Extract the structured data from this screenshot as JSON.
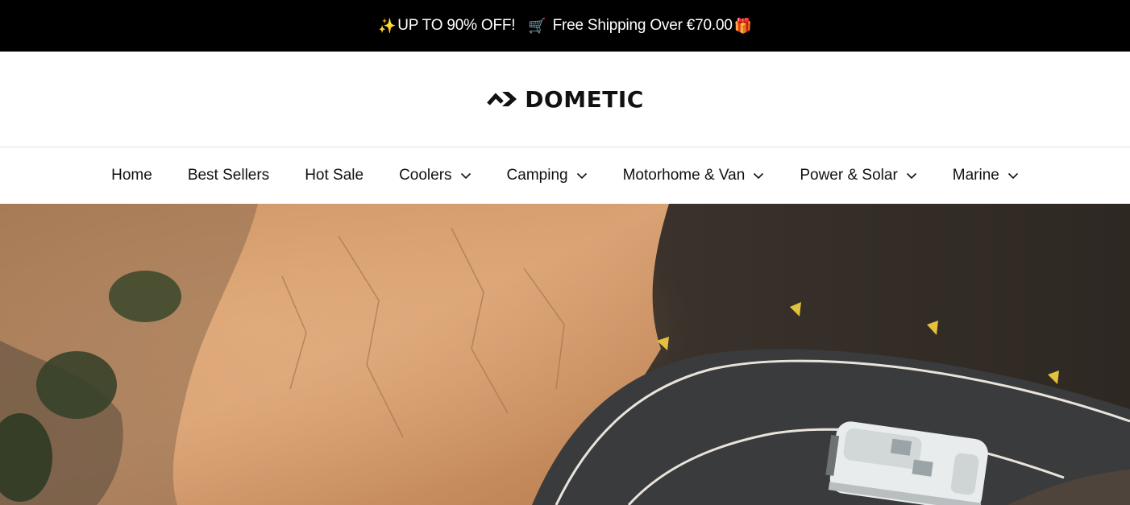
{
  "announcement": {
    "promo_emoji": "✨",
    "promo_text": "UP TO 90% OFF!",
    "cart_emoji": "🛒",
    "shipping_text": "Free Shipping Over €70.00",
    "gift_emoji": "🎁"
  },
  "header": {
    "logo_text": "DOMETIC"
  },
  "nav": {
    "items": [
      {
        "label": "Home",
        "has_dropdown": false
      },
      {
        "label": "Best Sellers",
        "has_dropdown": false
      },
      {
        "label": "Hot Sale",
        "has_dropdown": false
      },
      {
        "label": "Coolers",
        "has_dropdown": true
      },
      {
        "label": "Camping",
        "has_dropdown": true
      },
      {
        "label": "Motorhome & Van",
        "has_dropdown": true
      },
      {
        "label": "Power & Solar",
        "has_dropdown": true
      },
      {
        "label": "Marine",
        "has_dropdown": true
      }
    ]
  },
  "colors": {
    "announcement_bg": "#000000",
    "text": "#111111",
    "divider": "#e3e3e3"
  },
  "icons": {
    "logo": "dometic-logo-mark",
    "dropdown": "chevron-down-icon"
  }
}
